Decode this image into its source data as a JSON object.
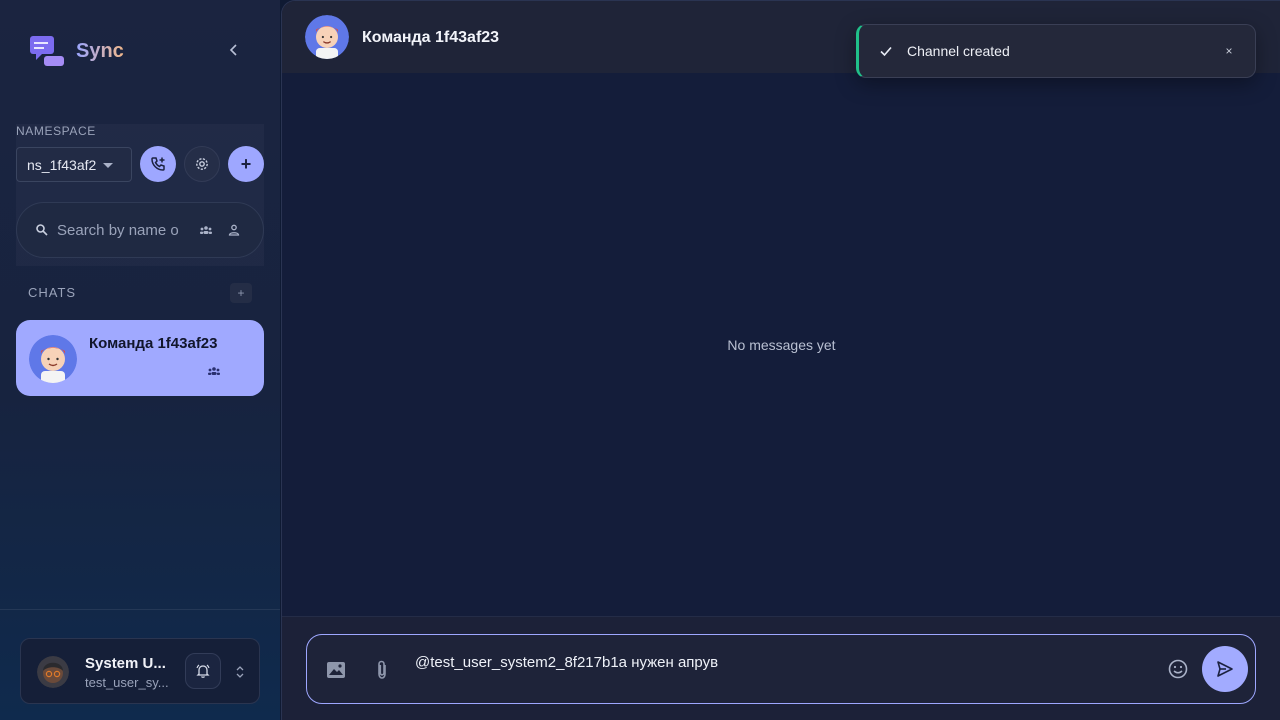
{
  "app": {
    "name": "Sync"
  },
  "sidebar": {
    "namespace_label": "NAMESPACE",
    "namespace_value": "ns_1f43af2",
    "search_placeholder": "Search by name o",
    "chats_label": "CHATS",
    "chats_add_label": "+",
    "plus_label": "+",
    "chats": [
      {
        "name": "Команда 1f43af23",
        "type": "group"
      }
    ]
  },
  "user": {
    "name": "System U...",
    "login": "test_user_sy..."
  },
  "chat": {
    "title": "Команда 1f43af23",
    "empty_text": "No messages yet",
    "composer_value": "@test_user_system2_8f217b1a нужен апрув"
  },
  "toast": {
    "message": "Channel created",
    "close_label": "×"
  },
  "icons": {
    "brand": "chat-bubbles-icon",
    "collapse": "chevron-left-icon",
    "call": "phone-add-icon",
    "settings": "gear-icon",
    "search": "search-icon",
    "group_filter": "group-icon",
    "user_filter": "person-icon",
    "bell": "bell-icon",
    "expand": "chevron-updown-icon",
    "image": "image-icon",
    "attach": "paperclip-icon",
    "emoji": "emoji-icon",
    "send": "send-icon",
    "check": "check-icon"
  },
  "colors": {
    "accent": "#a0a9ff",
    "toast_success": "#20c08a",
    "brand_gradient_start": "#9aa6ff",
    "brand_gradient_end": "#f2b88a"
  }
}
